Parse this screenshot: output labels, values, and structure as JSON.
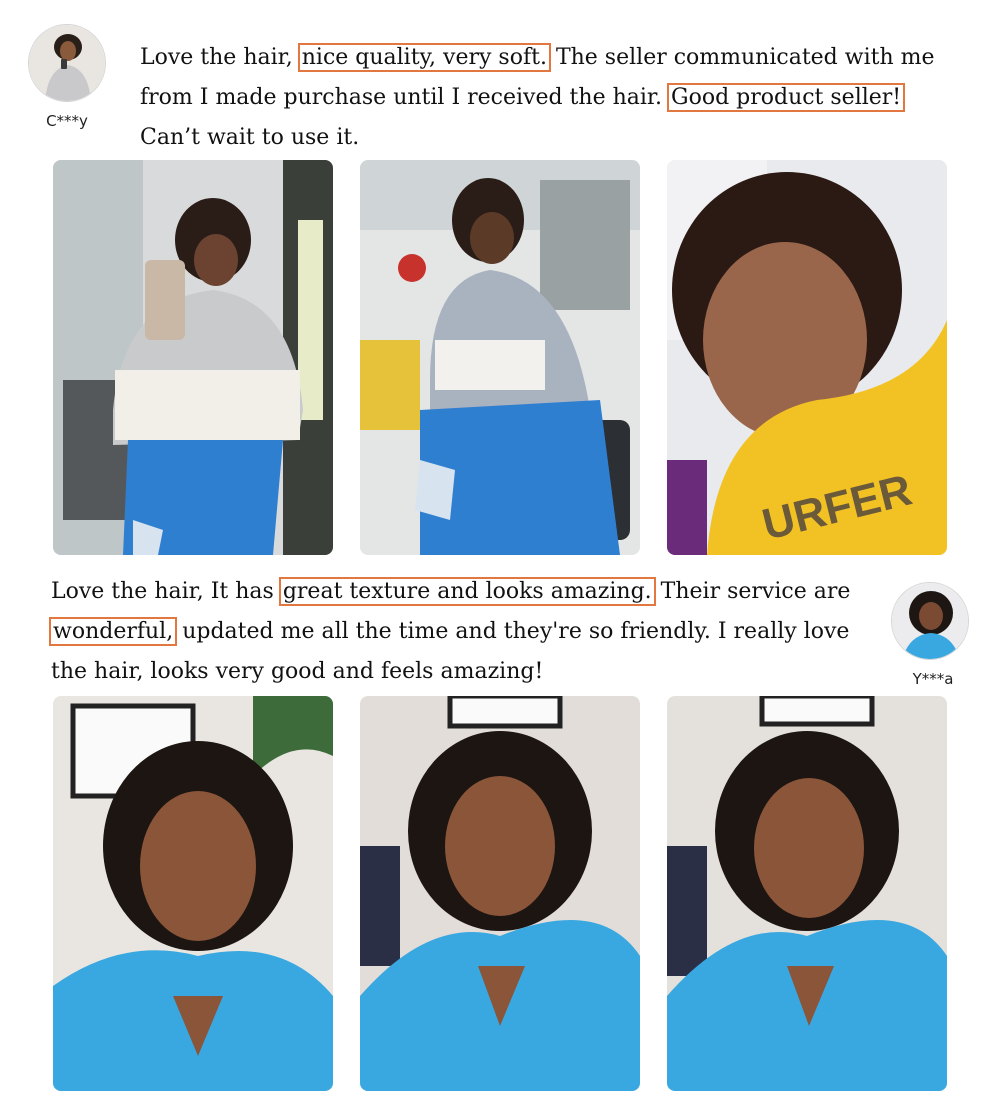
{
  "review1": {
    "reviewer": "C***y",
    "text_1": "Love the hair,",
    "highlight_1": "nice quality, very soft.",
    "text_2": "The seller communicated with me from I made purchase until I received the hair.",
    "highlight_2": "Good product seller!",
    "text_3": "Can’t wait to use it."
  },
  "review2": {
    "reviewer": "Y***a",
    "text_1": "Love the hair, It has",
    "highlight_1": "great texture and looks amazing.",
    "text_2": "Their service are",
    "highlight_2": "wonderful,",
    "text_3": "updated me all the time and they're so friendly. I really love the hair, looks very good and feels amazing!"
  },
  "colors": {
    "highlight_border": "#e2783f",
    "denim": "#2f7fd1",
    "sweatshirt_yellow": "#f2c225",
    "tie_dye_blue": "#3aa8e0"
  }
}
